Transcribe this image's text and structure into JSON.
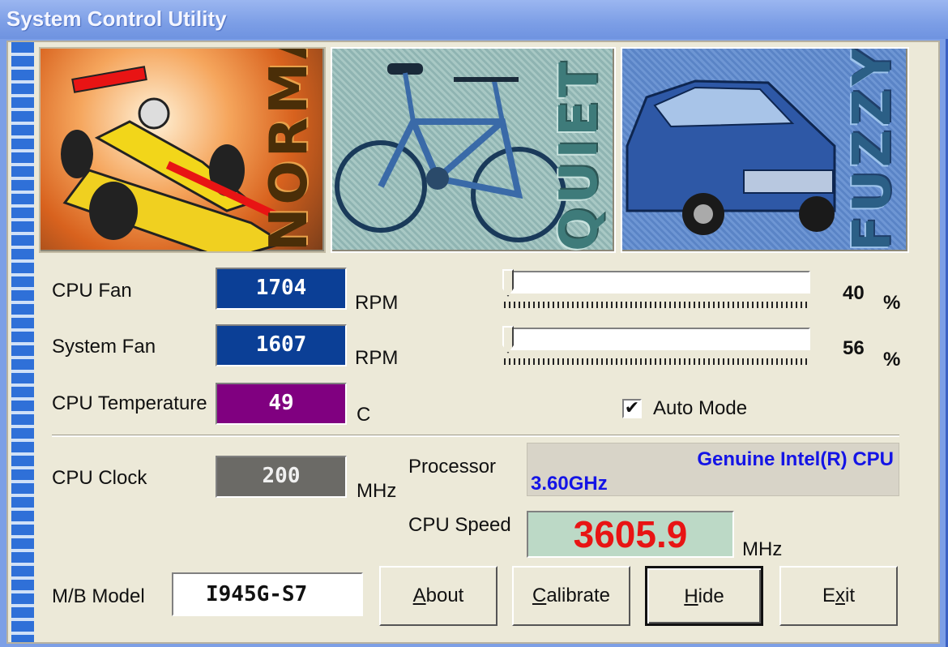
{
  "window": {
    "title": "System Control Utility"
  },
  "modes": [
    {
      "label": "NORMAL",
      "icon": "race-car-icon"
    },
    {
      "label": "QUIET",
      "icon": "bicycle-icon"
    },
    {
      "label": "FUZZY",
      "icon": "sedan-car-icon"
    }
  ],
  "fans": {
    "cpu": {
      "label": "CPU Fan",
      "value": "1704",
      "unit": "RPM",
      "percent": "40",
      "percent_sign": "%",
      "slider_fraction": 0.0
    },
    "system": {
      "label": "System Fan",
      "value": "1607",
      "unit": "RPM",
      "percent": "56",
      "percent_sign": "%",
      "slider_fraction": 0.0
    }
  },
  "temperature": {
    "label": "CPU Temperature",
    "value": "49",
    "unit": "C"
  },
  "auto_mode": {
    "label": "Auto Mode",
    "checked": true,
    "mark": "✔"
  },
  "clock": {
    "label": "CPU Clock",
    "value": "200",
    "unit": "MHz"
  },
  "processor": {
    "label": "Processor",
    "line1": "Genuine Intel(R) CPU",
    "line2": "3.60GHz"
  },
  "speed": {
    "label": "CPU Speed",
    "value": "3605.9",
    "unit": "MHz"
  },
  "mb": {
    "label": "M/B Model",
    "value": "I945G-S7"
  },
  "buttons": {
    "about": {
      "accel": "A",
      "rest": "bout"
    },
    "calibrate": {
      "accel": "C",
      "rest": "alibrate"
    },
    "hide": {
      "accel": "H",
      "rest": "ide"
    },
    "exit": {
      "pre": "E",
      "accel": "x",
      "rest": "it"
    }
  },
  "colors": {
    "fan_box": "#0b3f96",
    "temp_box": "#800080",
    "clock_box": "#6b6a66",
    "processor_text": "#1414e6",
    "speed_text": "#e81414",
    "speed_bg": "#bcd9c6"
  }
}
